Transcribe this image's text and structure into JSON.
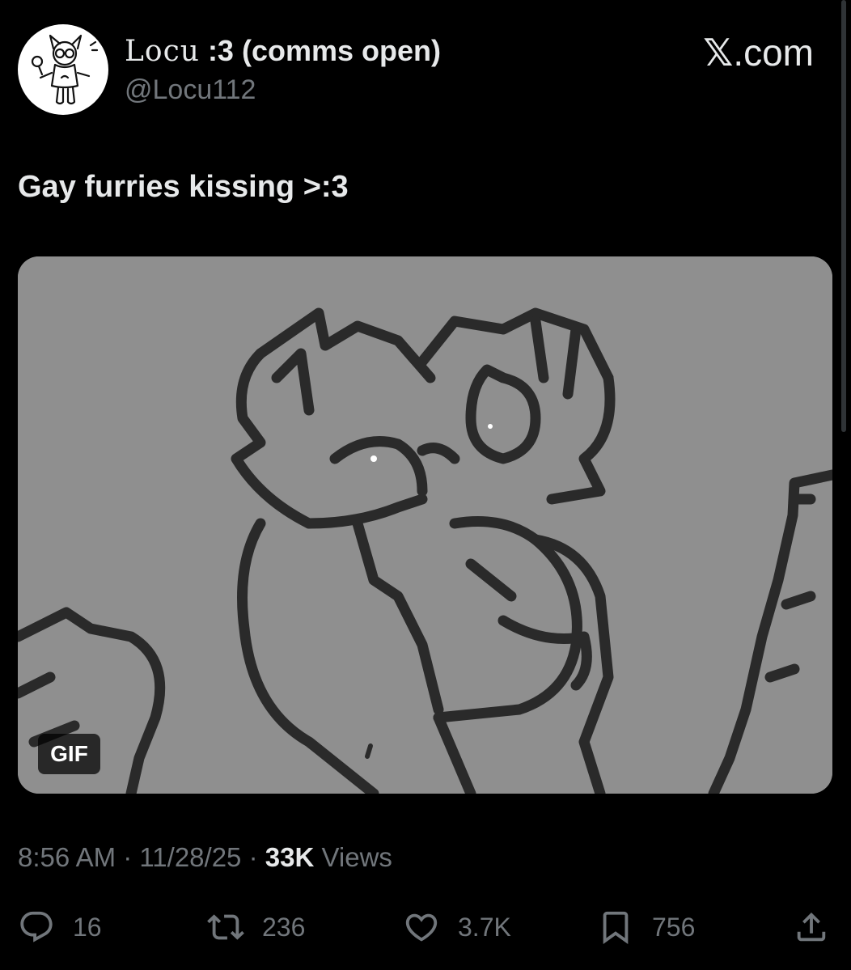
{
  "tweet": {
    "display_name_prefix": "Locu",
    "display_name_rest": " :3 (comms open)",
    "handle": "@Locu112",
    "site_x": "𝕏",
    "site_domain": ".com",
    "text": "Gay furries kissing >:3",
    "media": {
      "badge": "GIF"
    },
    "time": "8:56 AM",
    "separator": " · ",
    "date": "11/28/25",
    "views_count": "33K",
    "views_label": " Views"
  },
  "actions": {
    "replies": {
      "icon": "reply-icon",
      "count": "16"
    },
    "reposts": {
      "icon": "repost-icon",
      "count": "236"
    },
    "likes": {
      "icon": "heart-icon",
      "count": "3.7K"
    },
    "bookmarks": {
      "icon": "bookmark-icon",
      "count": "756"
    },
    "share": {
      "icon": "share-icon"
    }
  },
  "colors": {
    "background": "#000000",
    "primary_text": "#e7e9ea",
    "secondary_text": "#71767b",
    "media_background": "#8f8f8f"
  }
}
